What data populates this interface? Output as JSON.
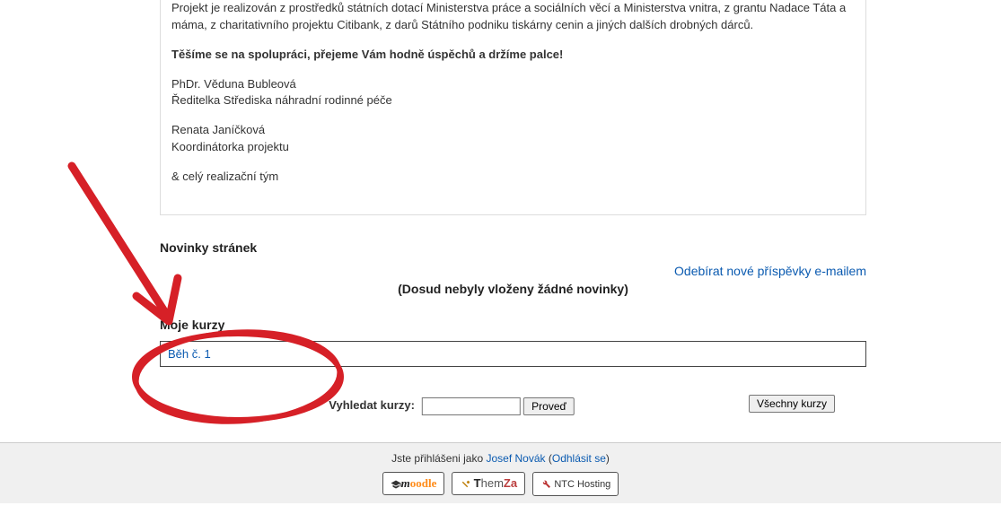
{
  "info": {
    "p1": "Projekt je realizován z prostředků státních dotací Ministerstva práce a sociálních věcí a Ministerstva vnitra, z grantu Nadace Táta a máma, z charitativního projektu Citibank, z darů Státního podniku tiskárny cenin a jiných dalších drobných dárců.",
    "p2_bold": "Těšíme se na spolupráci, přejeme Vám hodně úspěchů a držíme palce!",
    "p3a": "PhDr. Věduna Bubleová",
    "p3b": "Ředitelka Střediska náhradní rodinné péče",
    "p4a": "Renata Janíčková",
    "p4b": "Koordinátorka projektu",
    "p5": "& celý realizační tým"
  },
  "news": {
    "heading": "Novinky stránek",
    "subscribe": "Odebírat nové příspěvky e-mailem",
    "none": "(Dosud nebyly vloženy žádné novinky)"
  },
  "courses": {
    "heading": "Moje kurzy",
    "item1": "Běh č. 1"
  },
  "search": {
    "label": "Vyhledat kurzy:",
    "go": "Proveď",
    "all": "Všechny kurzy"
  },
  "footer": {
    "logged_in_prefix": "Jste přihlášeni jako ",
    "user": "Josef Novák",
    "logout": "Odhlásit se",
    "badges": {
      "moodle": "moodle",
      "themza": "ThemZa",
      "ntc": "NTC Hosting"
    }
  }
}
